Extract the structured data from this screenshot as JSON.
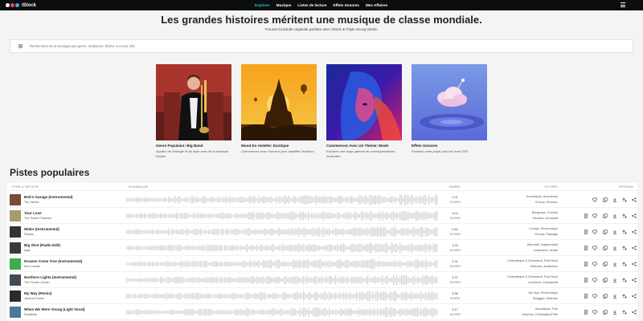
{
  "header": {
    "logo_text": "iStock",
    "logo_colors": [
      "#ffffff",
      "#e8417a",
      "#3ab0e0"
    ],
    "nav": [
      {
        "label": "Explorer",
        "active": true
      },
      {
        "label": "Musique",
        "active": false
      },
      {
        "label": "Listes de lecture",
        "active": false
      },
      {
        "label": "Effets Sonores",
        "active": false
      },
      {
        "label": "Mes Affaires",
        "active": false
      }
    ],
    "menu_icon": "hamburger-icon"
  },
  "hero": {
    "title": "Les grandes histoires méritent une musique de classe mondiale.",
    "subtitle": "Trouvez la bande originale parfaite avec iStock & Triple Scoop Music.",
    "search_placeholder": "Recherchez de la musique par genre, ambiance, thème ou mots clés"
  },
  "cards": [
    {
      "title": "Genre Populaire: Big Band",
      "desc": "Ajoutez de l'énergie et du style avec de la musique fraîche",
      "icon": "trombone-player-image"
    },
    {
      "title": "Mood En Vedette: Exotique",
      "desc": "Commencez avec l'humeur pour amplifier l'émotion",
      "icon": "temple-sunset-image"
    },
    {
      "title": "Commencez Avec Un Thème: Mode",
      "desc": "Explorez une large gamme de correspondances musicales",
      "icon": "fashion-portrait-image"
    },
    {
      "title": "Effets Sonores",
      "desc": "Poussez votre projet plus loin avec SFX",
      "icon": "cloud-water-image"
    }
  ],
  "tracks_section": {
    "title": "Pistes populaires",
    "headers": {
      "title": "TITRE & ARTISTE",
      "dynamic": "DYNAMIQUE",
      "duration": "DURÉE",
      "filters": "FILTRES",
      "options": "OPTIONS"
    },
    "rows": [
      {
        "title": "Bob's Garage (Instrumental)",
        "artist": "Tim James",
        "duration": "2:01",
        "bpm": "124 BPM",
        "filter1": "Acoustique, Americana",
        "filter2": "Groovy, Heureux",
        "thumb": "#7a4a3a"
      },
      {
        "title": "Your Love",
        "artist": "The Sweet Potatoes",
        "duration": "3:04",
        "bpm": "116 BPM",
        "filter1": "Bluegrass, Country",
        "filter2": "Heureux, Amusant",
        "thumb": "#a89a6a"
      },
      {
        "title": "Wider (Instrumental)",
        "artist": "Sharks",
        "duration": "2:52",
        "bpm": "110 BPM",
        "filter1": "Lounge, Electronique",
        "filter2": "Groovy, Passage",
        "thumb": "#333333"
      },
      {
        "title": "Big Shot (Radio Edit)",
        "artist": "Agst",
        "duration": "3:29",
        "bpm": "102 BPM",
        "filter1": "Alternatif, Indépendant",
        "filter2": "Audacieux, Arabe",
        "thumb": "#3a3a3a"
      },
      {
        "title": "Dreams Come True (Instrumental)",
        "artist": "Alex Lander",
        "duration": "2:31",
        "bpm": "136 BPM",
        "filter1": "Cinématique & Orchestral, Post Rock",
        "filter2": "Motivant, Audacieux",
        "thumb": "#3fae4a"
      },
      {
        "title": "Northern Lights (Instrumental)",
        "artist": "The Frozen Ocean",
        "duration": "4:37",
        "bpm": "108 BPM",
        "filter1": "Cinématique & Orchestral, Post Rock",
        "filter2": "Lumineux, Introspectif",
        "thumb": "#444a52"
      },
      {
        "title": "My Way (Remix)",
        "artist": "Jackson Fisher",
        "duration": "3:36",
        "bpm": "96 BPM",
        "filter1": "Hip Hop, Electronique",
        "filter2": "Swagger, Détendu",
        "thumb": "#2a2a2a"
      },
      {
        "title": "When We Were Young (Light Vocal)",
        "artist": "Roadside",
        "duration": "3:17",
        "bpm": "115 BPM",
        "filter1": "Acoustique, Folk",
        "filter2": "Heureux, Célébration/Fête",
        "thumb": "#4a7a9a"
      }
    ],
    "option_icons": [
      "heart-icon",
      "copy-icon",
      "download-icon",
      "playlist-add-icon",
      "share-icon"
    ],
    "lyric_icon": "lyrics-icon"
  }
}
